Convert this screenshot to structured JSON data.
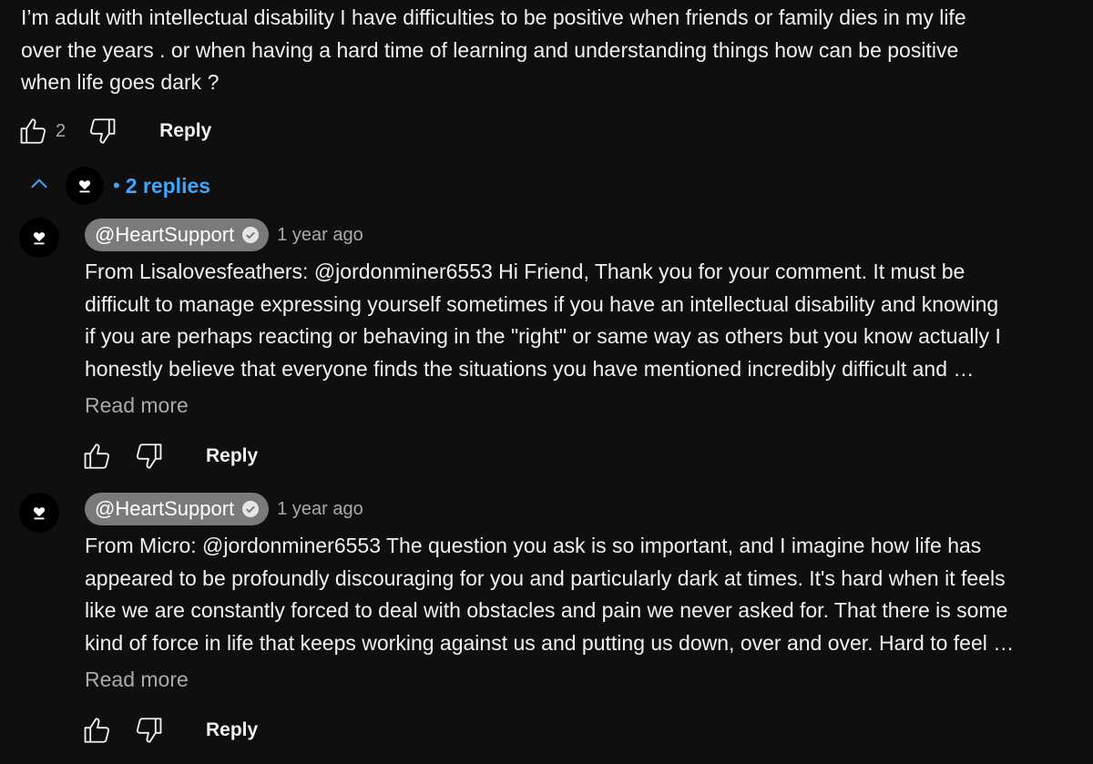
{
  "comment": {
    "text": "I’m adult with intellectual disability I have difficulties to be positive when  friends or family dies in my life\nover the years . or when  having a hard time of learning and understanding things how can be positive\nwhen life  goes dark  ?",
    "like_count": "2",
    "reply_label": "Reply"
  },
  "replies_toggle": {
    "separator": "•",
    "label": "2 replies"
  },
  "replies": [
    {
      "author": "@HeartSupport",
      "time": "1 year ago",
      "text": "From Lisalovesfeathers: @jordonminer6553 Hi Friend, Thank you for your comment. It must be\ndifficult to manage expressing yourself sometimes if you have an intellectual disability and knowing\nif you are perhaps reacting or behaving in the \"right\" or same way as others but you know actually I\nhonestly believe that everyone finds the situations you have mentioned incredibly difficult and …",
      "read_more": "Read more",
      "reply_label": "Reply"
    },
    {
      "author": "@HeartSupport",
      "time": "1 year ago",
      "text": "From Micro: @jordonminer6553 The question you ask is so important, and I imagine how life has\nappeared to be profoundly discouraging for you and particularly dark at times. It's hard when it feels\nlike we are constantly forced to deal with obstacles and pain we never asked for. That there is some\nkind of force in life that keeps working against us and putting us down, over and over. Hard to feel …",
      "read_more": "Read more",
      "reply_label": "Reply"
    }
  ],
  "icons": {
    "like": "thumbs-up-icon",
    "dislike": "thumbs-down-icon",
    "collapse": "chevron-up-icon",
    "avatar": "heart-icon",
    "verified": "verified-check-icon"
  },
  "colors": {
    "background": "#0f0f0f",
    "text": "#f1f1f1",
    "secondary_text": "#aaaaaa",
    "link_blue": "#3ea6ff",
    "author_chip": "#7a7a7a"
  }
}
